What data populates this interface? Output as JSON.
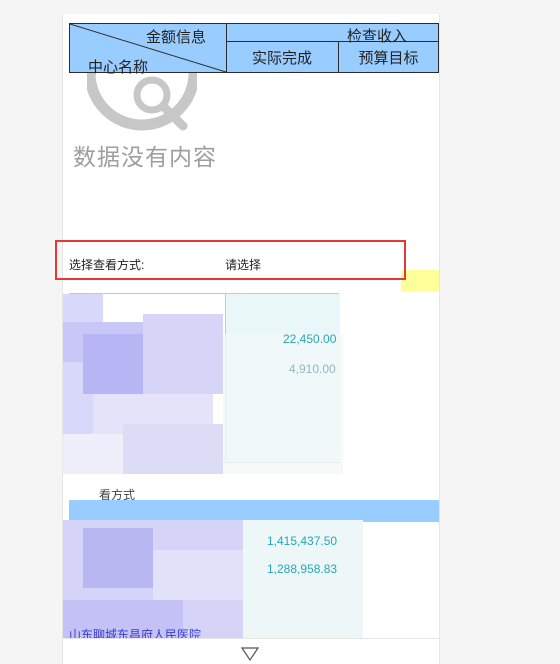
{
  "table_header": {
    "amount_info": "金额信息",
    "center_name": "中心名称",
    "group_title": "检查收入",
    "col_actual": "实际完成",
    "col_budget": "预算目标"
  },
  "empty_state": {
    "message": "数据没有内容"
  },
  "filter": {
    "label": "选择查看方式:",
    "placeholder": "请选择"
  },
  "blurred_values": {
    "v1": "22,450.00",
    "v2": "4,910.00",
    "v3": "1,415,437.50",
    "v4": "1,288,958.83"
  },
  "blurred_texts": {
    "t1": "看方式",
    "t2": "山东聊城东昌府人民医院"
  },
  "colors": {
    "header_bg": "#99ccff",
    "highlight_border": "#e53935",
    "value_text": "#26a7b5"
  },
  "icons": {
    "bottom": "chevron-down-icon",
    "empty": "magnifier-icon"
  }
}
